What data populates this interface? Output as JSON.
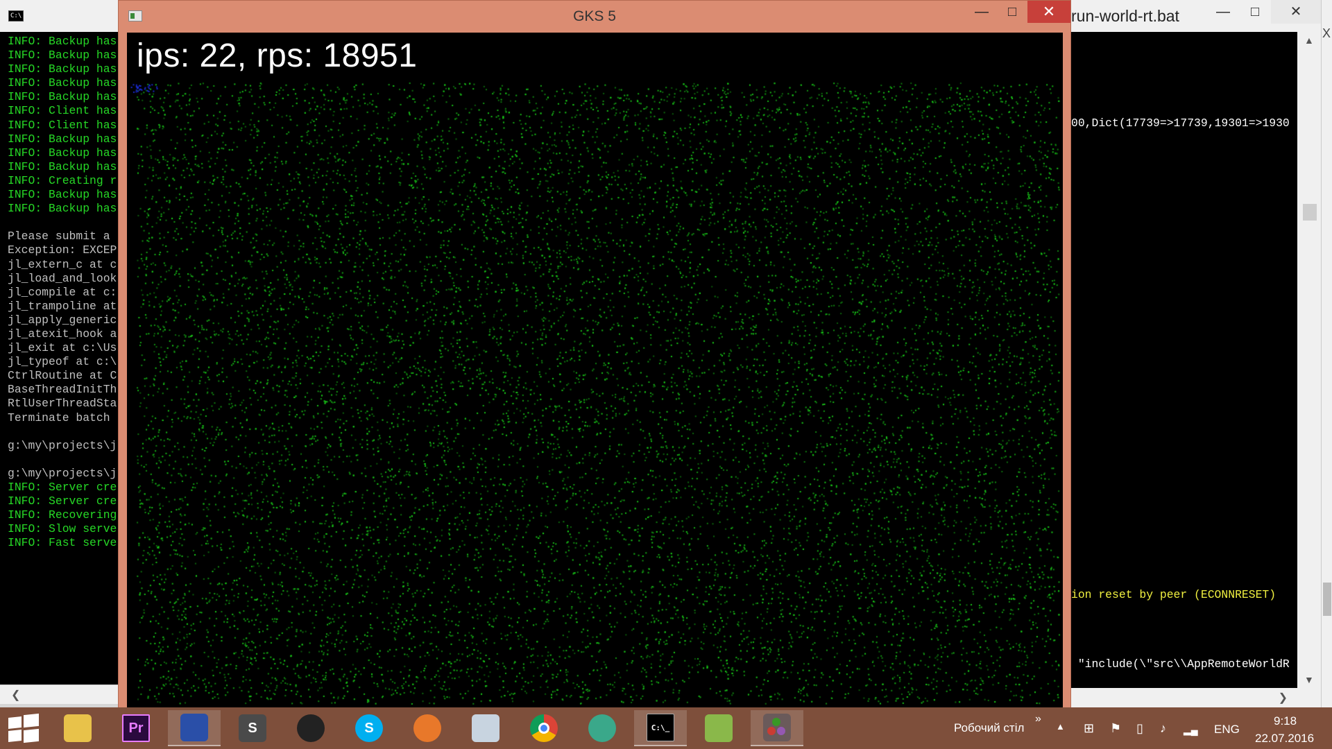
{
  "left_console": {
    "lines": [
      {
        "text": "INFO: Backup has",
        "color": "green"
      },
      {
        "text": "INFO: Backup has",
        "color": "green"
      },
      {
        "text": "INFO: Backup has",
        "color": "green"
      },
      {
        "text": "INFO: Backup has",
        "color": "green"
      },
      {
        "text": "INFO: Backup has",
        "color": "green"
      },
      {
        "text": "INFO: Client has",
        "color": "green"
      },
      {
        "text": "INFO: Client has",
        "color": "green"
      },
      {
        "text": "INFO: Backup has",
        "color": "green"
      },
      {
        "text": "INFO: Backup has",
        "color": "green"
      },
      {
        "text": "INFO: Backup has",
        "color": "green"
      },
      {
        "text": "INFO: Creating r",
        "color": "green"
      },
      {
        "text": "INFO: Backup has",
        "color": "green"
      },
      {
        "text": "INFO: Backup has",
        "color": "green"
      },
      {
        "text": "",
        "color": "white"
      },
      {
        "text": "Please submit a ",
        "color": "white"
      },
      {
        "text": "Exception: EXCEP",
        "color": "white"
      },
      {
        "text": "jl_extern_c at c",
        "color": "white"
      },
      {
        "text": "jl_load_and_look",
        "color": "white"
      },
      {
        "text": "jl_compile at c:",
        "color": "white"
      },
      {
        "text": "jl_trampoline at",
        "color": "white"
      },
      {
        "text": "jl_apply_generic",
        "color": "white"
      },
      {
        "text": "jl_atexit_hook a",
        "color": "white"
      },
      {
        "text": "jl_exit at c:\\Us",
        "color": "white"
      },
      {
        "text": "jl_typeof at c:\\",
        "color": "white"
      },
      {
        "text": "CtrlRoutine at C",
        "color": "white"
      },
      {
        "text": "BaseThreadInitTh",
        "color": "white"
      },
      {
        "text": "RtlUserThreadSta",
        "color": "white"
      },
      {
        "text": "Terminate batch ",
        "color": "white"
      },
      {
        "text": "",
        "color": "white"
      },
      {
        "text": "g:\\my\\projects\\j",
        "color": "white"
      },
      {
        "text": "",
        "color": "white"
      },
      {
        "text": "g:\\my\\projects\\j",
        "color": "white"
      },
      {
        "text": "INFO: Server cre",
        "color": "green"
      },
      {
        "text": "INFO: Server cre",
        "color": "green"
      },
      {
        "text": "INFO: Recovering",
        "color": "green"
      },
      {
        "text": "INFO: Slow serve",
        "color": "green"
      },
      {
        "text": "INFO: Fast serve",
        "color": "green"
      }
    ]
  },
  "right_console": {
    "title": "run-world-rt.bat",
    "min_glyph": "—",
    "max_glyph": "□",
    "close_glyph": "✕",
    "line_dict": "00,Dict(17739=>17739,19301=>1930",
    "line_error": "ion reset by peer (ECONNRESET)",
    "line_include": " \"include(\\\"src\\\\AppRemoteWorldR",
    "colors": {
      "dict": "#ffffff",
      "error": "#f0f040",
      "include": "#ffffff"
    }
  },
  "gks_window": {
    "title": "GKS 5",
    "min_glyph": "—",
    "max_glyph": "□",
    "close_glyph": "✕",
    "stats": "ips: 22, rps: 18951",
    "particle_color": "#19c819",
    "frame_color": "#db8c72"
  },
  "taskbar": {
    "apps": [
      {
        "name": "file-explorer",
        "label": "",
        "bg": "#e8c24a"
      },
      {
        "name": "premiere-pro",
        "label": "Pr",
        "bg": "#2a0a3e"
      },
      {
        "name": "save-app",
        "label": "",
        "bg": "#2a4fa8"
      },
      {
        "name": "sublime-text",
        "label": "S",
        "bg": "#4a4a4a"
      },
      {
        "name": "red-app",
        "label": "",
        "bg": "#222222"
      },
      {
        "name": "skype",
        "label": "S",
        "bg": "#00aff0"
      },
      {
        "name": "hot-app",
        "label": "",
        "bg": "#e8782a"
      },
      {
        "name": "performance-monitor",
        "label": "",
        "bg": "#c8d4e0"
      },
      {
        "name": "chrome",
        "label": "",
        "bg": "#ffffff"
      },
      {
        "name": "atom",
        "label": "",
        "bg": "#3aa88a"
      },
      {
        "name": "command-prompt",
        "label": "C:\\_",
        "bg": "#000000"
      },
      {
        "name": "notepad-plus",
        "label": "",
        "bg": "#8ab84a"
      },
      {
        "name": "julia",
        "label": "",
        "bg": "#6a5a5a"
      }
    ],
    "desktop_label": "Робочий стіл",
    "chevron": "»",
    "language": "ENG",
    "time": "9:18",
    "date": "22.07.2016"
  }
}
